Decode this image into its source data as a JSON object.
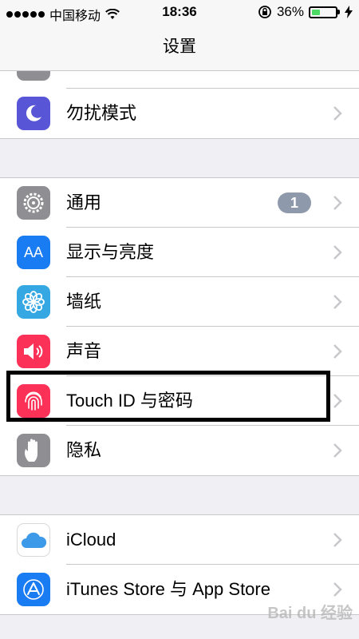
{
  "status_bar": {
    "carrier": "中国移动",
    "time": "18:36",
    "battery_percent": "36%",
    "battery_level": 0.36,
    "icons": [
      "signal-dots-icon",
      "wifi-icon",
      "rotation-lock-icon",
      "battery-icon",
      "charging-icon"
    ]
  },
  "nav": {
    "title": "设置"
  },
  "rows": {
    "dnd": {
      "label": "勿扰模式",
      "icon": "moon-icon",
      "color": "#5856d6"
    },
    "general": {
      "label": "通用",
      "badge": "1",
      "icon": "gear-icon",
      "color": "#8e8e93"
    },
    "display": {
      "label": "显示与亮度",
      "icon_text": "AA",
      "icon": "text-size-icon",
      "color": "#1a7cf2"
    },
    "wallpaper": {
      "label": "墙纸",
      "icon": "flower-icon",
      "color": "#35a7e3"
    },
    "sounds": {
      "label": "声音",
      "icon": "speaker-icon",
      "color": "#fc3158"
    },
    "touchid": {
      "label": "Touch ID 与密码",
      "icon": "fingerprint-icon",
      "color": "#fc3158"
    },
    "privacy": {
      "label": "隐私",
      "icon": "hand-icon",
      "color": "#8e8e93"
    },
    "icloud": {
      "label": "iCloud",
      "icon": "cloud-icon",
      "color": "#ffffff"
    },
    "itunes": {
      "label": "iTunes Store 与 App Store",
      "icon": "app-store-icon",
      "color": "#1a7cf2"
    }
  },
  "watermark": "Bai du 经验"
}
